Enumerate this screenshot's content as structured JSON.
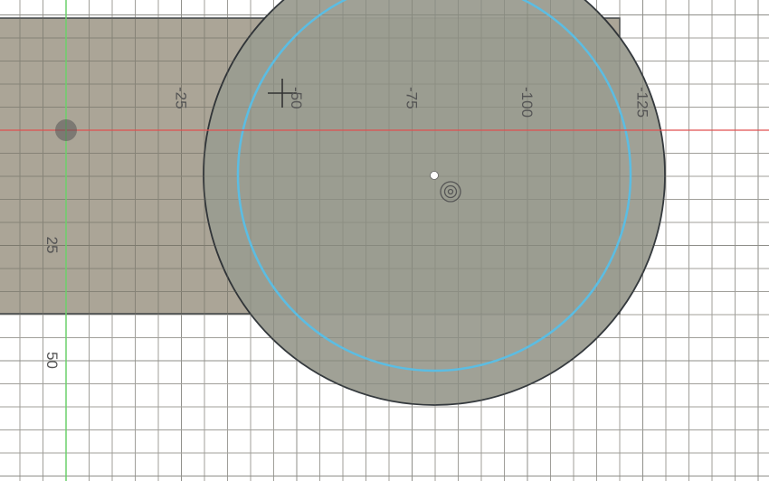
{
  "viewport": {
    "axis_labels_x": [
      "-25",
      "-50",
      "-75",
      "-100",
      "-125"
    ],
    "axis_labels_y": [
      "25",
      "50"
    ]
  },
  "colors": {
    "x_axis": "#e05050",
    "y_axis": "#6cd06c",
    "body_fill": "#a39c8c",
    "circle_fill": "#9b9d91",
    "construction_circle": "#5bbde3",
    "outline": "#2a2f33"
  },
  "icons": [
    "origin-icon",
    "crosshair-cursor-icon",
    "center-point-icon",
    "sketch-point-icon"
  ]
}
